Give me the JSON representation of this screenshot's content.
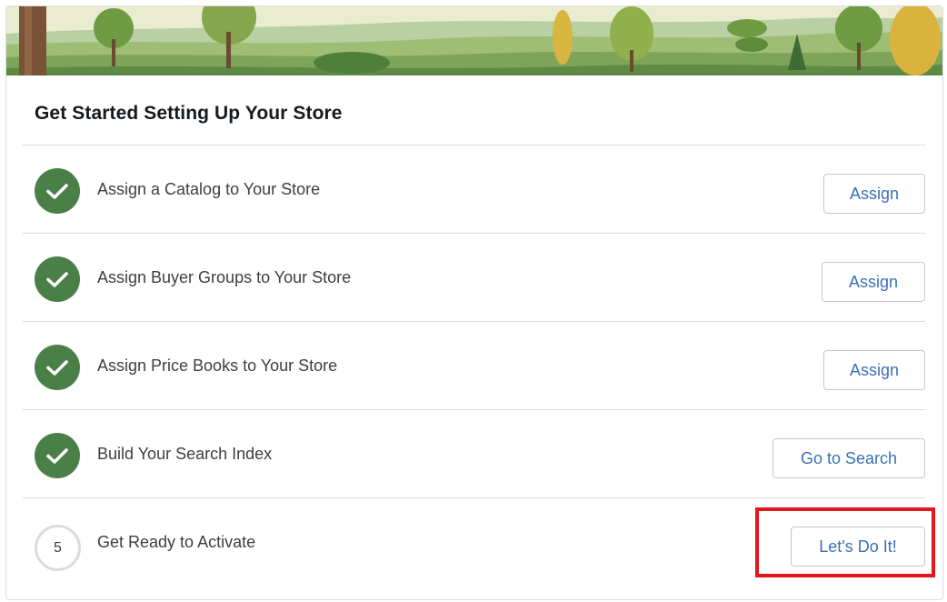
{
  "card": {
    "title": "Get Started Setting Up Your Store"
  },
  "steps": [
    {
      "status": "complete",
      "icon": "checkmark-icon",
      "label": "Assign a Catalog to Your Store",
      "button": "Assign"
    },
    {
      "status": "complete",
      "icon": "checkmark-icon",
      "label": "Assign Buyer Groups to Your Store",
      "button": "Assign"
    },
    {
      "status": "complete",
      "icon": "checkmark-icon",
      "label": "Assign Price Books to Your Store",
      "button": "Assign"
    },
    {
      "status": "complete",
      "icon": "checkmark-icon",
      "label": "Build Your Search Index",
      "button": "Go to Search"
    },
    {
      "status": "incomplete",
      "number": "5",
      "label": "Get Ready to Activate",
      "button": "Let's Do It!"
    }
  ],
  "colors": {
    "complete": "#4a7f47",
    "button_text": "#3a70b5",
    "highlight": "#e1161f"
  }
}
